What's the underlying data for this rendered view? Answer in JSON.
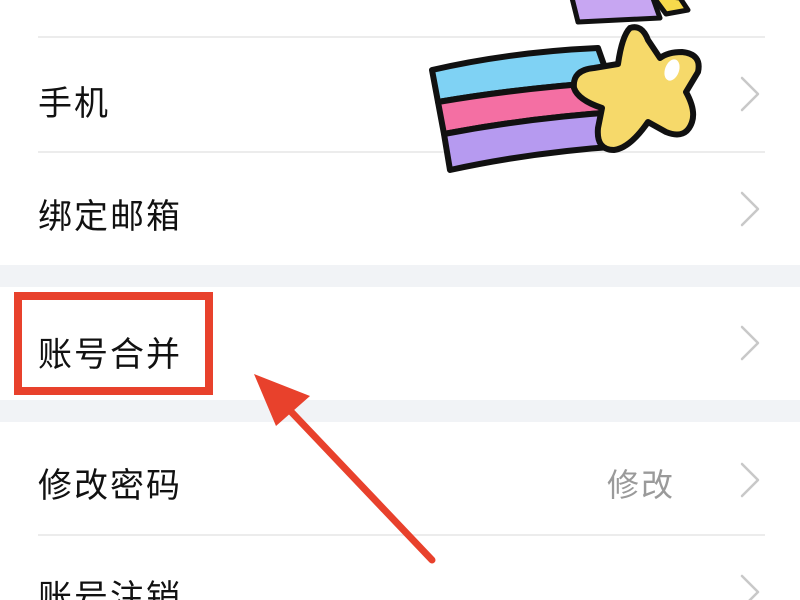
{
  "settings": {
    "items": [
      {
        "label": "手机",
        "value": ""
      },
      {
        "label": "绑定邮箱",
        "value": ""
      },
      {
        "label": "账号合并",
        "value": ""
      },
      {
        "label": "修改密码",
        "value": "修改"
      },
      {
        "label": "账号注销",
        "value": ""
      }
    ]
  },
  "icons": {
    "row_arrow": "chevron-right-icon",
    "decoration": "shooting-star-sticker",
    "annotation_arrow": "red-pointer-arrow"
  },
  "colors": {
    "highlight": "#e8412c",
    "arrow": "#e8412c",
    "section_gap": "#f1f3f6",
    "divider": "#ececec",
    "chevron": "#c8c8c8",
    "value_text": "#9a9a9a"
  }
}
